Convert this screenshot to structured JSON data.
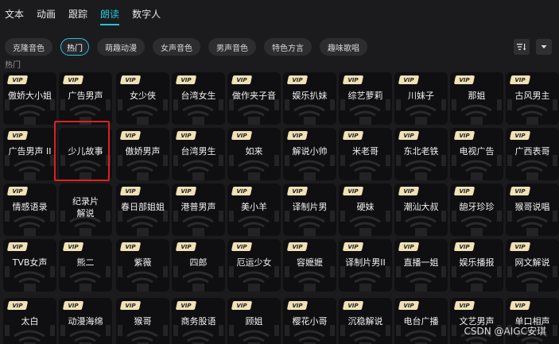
{
  "top_tabs": [
    {
      "label": "文本"
    },
    {
      "label": "动画"
    },
    {
      "label": "跟踪"
    },
    {
      "label": "朗读",
      "active": true
    },
    {
      "label": "数字人"
    }
  ],
  "chips": [
    {
      "label": "克隆音色"
    },
    {
      "label": "热门",
      "active": true
    },
    {
      "label": "萌趣动漫"
    },
    {
      "label": "女声音色"
    },
    {
      "label": "男声音色"
    },
    {
      "label": "特色方言"
    },
    {
      "label": "趣味歌唱"
    }
  ],
  "toolbar": {
    "filter_icon": "filter-sort-icon",
    "dropdown_icon": "chevron-down-icon"
  },
  "section_label": "热门",
  "vip_label": "VIP",
  "voices": [
    {
      "name": "傲娇大小姐",
      "vip": true
    },
    {
      "name": "广告男声",
      "vip": true
    },
    {
      "name": "女少侠",
      "vip": true
    },
    {
      "name": "台湾女生",
      "vip": true
    },
    {
      "name": "做作夹子音",
      "vip": true
    },
    {
      "name": "娱乐扒妹",
      "vip": true
    },
    {
      "name": "综艺萝莉",
      "vip": true
    },
    {
      "name": "川妹子",
      "vip": true
    },
    {
      "name": "那姐",
      "vip": true
    },
    {
      "name": "古风男主",
      "vip": true
    },
    {
      "name": "广告男声 II",
      "vip": true
    },
    {
      "name": "少儿故事",
      "vip": false
    },
    {
      "name": "傲娇男声",
      "vip": true
    },
    {
      "name": "台湾男生",
      "vip": true
    },
    {
      "name": "如来",
      "vip": true
    },
    {
      "name": "解说小帅",
      "vip": true
    },
    {
      "name": "米老哥",
      "vip": true
    },
    {
      "name": "东北老铁",
      "vip": true
    },
    {
      "name": "电视广告",
      "vip": true
    },
    {
      "name": "广西表哥",
      "vip": true
    },
    {
      "name": "情感语录",
      "vip": true
    },
    {
      "name": "纪录片\n解说",
      "vip": false
    },
    {
      "name": "春日部姐姐",
      "vip": true
    },
    {
      "name": "港普男声",
      "vip": true
    },
    {
      "name": "美小羊",
      "vip": true
    },
    {
      "name": "译制片男",
      "vip": true
    },
    {
      "name": "硬妹",
      "vip": true
    },
    {
      "name": "潮汕大叔",
      "vip": true
    },
    {
      "name": "龅牙珍珍",
      "vip": true
    },
    {
      "name": "猴哥说唱",
      "vip": true
    },
    {
      "name": "TVB女声",
      "vip": true
    },
    {
      "name": "熊二",
      "vip": true
    },
    {
      "name": "紫薇",
      "vip": true
    },
    {
      "name": "四郎",
      "vip": true
    },
    {
      "name": "厄运少女",
      "vip": true
    },
    {
      "name": "容嬷嬷",
      "vip": true
    },
    {
      "name": "译制片男II",
      "vip": true
    },
    {
      "name": "直播一姐",
      "vip": true
    },
    {
      "name": "娱乐播报",
      "vip": true
    },
    {
      "name": "网文解说",
      "vip": true
    },
    {
      "name": "太白",
      "vip": true
    },
    {
      "name": "动漫海绵",
      "vip": true
    },
    {
      "name": "猴哥",
      "vip": true
    },
    {
      "name": "商务股语",
      "vip": true
    },
    {
      "name": "顾姐",
      "vip": true
    },
    {
      "name": "樱花小哥",
      "vip": true
    },
    {
      "name": "沉稳解说",
      "vip": true
    },
    {
      "name": "电台广播",
      "vip": true
    },
    {
      "name": "文艺男声",
      "vip": true
    },
    {
      "name": "单口相声",
      "vip": true
    }
  ],
  "highlighted_voice": "少儿故事",
  "watermark": "CSDN @AIGC安琪",
  "colors": {
    "accent": "#23c6d8",
    "highlight": "#e02020",
    "vip_badge": "#f0e2b6",
    "background": "#1b1b1d"
  }
}
